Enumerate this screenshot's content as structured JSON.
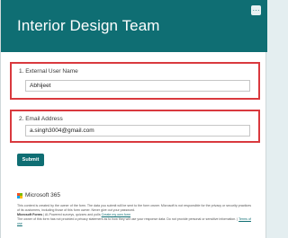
{
  "header": {
    "title": "Interior Design Team",
    "more_label": "···",
    "color": "#0f6e73"
  },
  "questions": [
    {
      "label": "1. External User Name",
      "value": "Abhijeet"
    },
    {
      "label": "2. Email Address",
      "value": "a.singh3004@gmail.com"
    }
  ],
  "submit_label": "Submit",
  "branding": {
    "label": "Microsoft 365",
    "logo_colors": [
      "#f25022",
      "#7fba00",
      "#00a4ef",
      "#ffb900"
    ]
  },
  "footer": {
    "line1": "This content is created by the owner of the form. The data you submit will be sent to the form owner. Microsoft is not responsible for the privacy or security practices of its customers, including those of this form owner. Never give out your password.",
    "line2_brand": "Microsoft Forms",
    "line2_text": " | AI-Powered surveys, quizzes and polls ",
    "line2_link": "Create my own form",
    "line3": "The owner of this form has not provided a privacy statement as to how they will use your response data. Do not provide personal or sensitive information. | ",
    "line3_link": "Terms of use"
  },
  "highlight_color": "#d9393e"
}
